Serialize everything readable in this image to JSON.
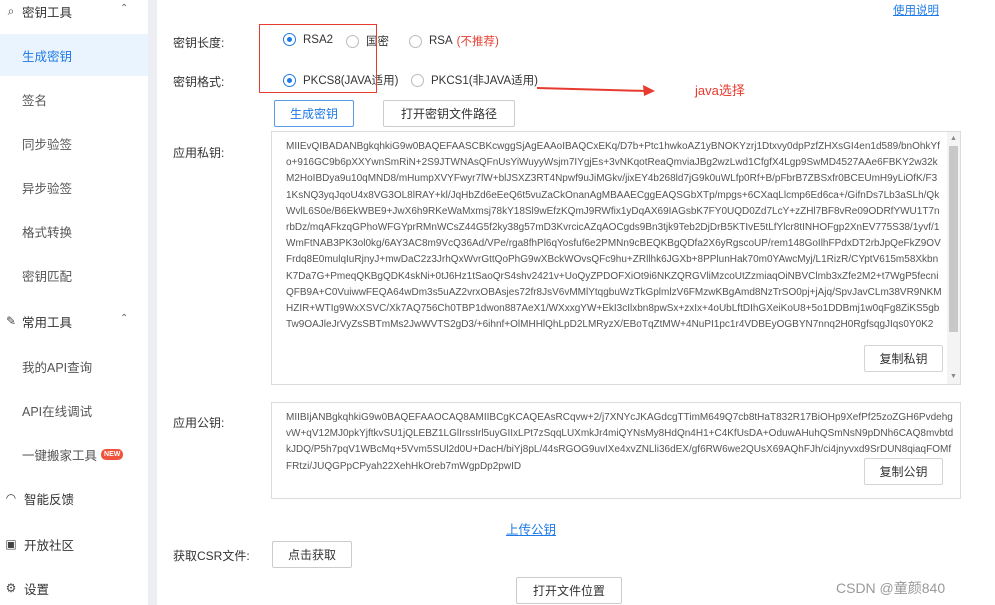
{
  "sidebar": {
    "group1": {
      "label": "密钥工具",
      "icon": "search-icon"
    },
    "items1": [
      {
        "label": "生成密钥",
        "active": true
      },
      {
        "label": "签名"
      },
      {
        "label": "同步验签"
      },
      {
        "label": "异步验签"
      },
      {
        "label": "格式转换"
      },
      {
        "label": "密钥匹配"
      }
    ],
    "group2": {
      "label": "常用工具",
      "icon": "wrench-icon"
    },
    "items2": [
      {
        "label": "我的API查询"
      },
      {
        "label": "API在线调试"
      },
      {
        "label": "一键搬家工具",
        "badge": "NEW"
      }
    ],
    "bottom": [
      {
        "label": "智能反馈",
        "icon": "headset-icon"
      },
      {
        "label": "开放社区",
        "icon": "community-icon"
      },
      {
        "label": "设置",
        "icon": "gear-icon"
      }
    ]
  },
  "main": {
    "help_link": "使用说明",
    "key_length": {
      "label": "密钥长度:",
      "options": [
        "RSA2",
        "国密",
        "RSA"
      ],
      "selected": "RSA2",
      "rsa_warning": "(不推荐)"
    },
    "key_format": {
      "label": "密钥格式:",
      "options": [
        "PKCS8(JAVA适用)",
        "PKCS1(非JAVA适用)"
      ],
      "selected": "PKCS8(JAVA适用)"
    },
    "annotation": "java选择",
    "buttons": {
      "generate": "生成密钥",
      "open_path": "打开密钥文件路径"
    },
    "private_key": {
      "label": "应用私钥:",
      "value": "MIIEvQIBADANBgkqhkiG9w0BAQEFAASCBKcwggSjAgEAAoIBAQCxEKq/D7b+Ptc1hwkoAZ1yBNOKYzrj1Dtxvy0dpPzfZHXsGI4en1d589/bnOhkYfo+916GC9b6pXXYwnSmRiN+2S9JTWNAsQFnUsYiWuyyWsjm7IYgjEs+3vNKqotReaQmviaJBg2wzLwd1CfgfX4Lgp9SwMD4527AAe6FBKY2w32kM2HoIBDya9u10qMND8/mHumpXVYFwyr7lW+blJSXZ3RT4Npwf9uJiMGkv/jixEY4b268ld7jG9k0uWLfp0Rf+B/pFbrB7ZBSxfr0BCEUmH9yLiOfK/F31KsNQ3yqJqoU4x8VG3OL8lRAY+kl/JqHbZd6eEeQ6t5vuZaCkOnanAgMBAAECggEAQSGbXTp/mpgs+6CXaqLlcmp6Ed6ca+/GifnDs7Lb3aSLh/QkWvlL6S0e/B6EkWBE9+JwX6h9RKeWaMxmsj78kY18Sl9wEfzKQmJ9RWfix1yDqAX69IAGsbK7FY0UQD0Zd7LcY+zZHl7BF8vRe09ODRfYWU1T7nrbDz/mqAFkzqGPhoWFGYprRMnWCsZ44G5f2ky38g57mD3KvrcicAZqAOCgds9Bn3tjk9Teb2DjDrB5KTIvE5tLfYlcr8tINHOFgp2XnEV775S38/1yvf/1WmFtNAB3PK3ol0kg/6AY3AC8m9VcQ36Ad/VPe/rga8fhPl6qYosfuf6e2PMNn9cBEQKBgQDfa2X6yRgscoUP/rem148GoIlhFPdxDT2rbJpQeFkZ9OVFrdq8E0mulqIuRjnyJ+mwDaC2z3JrhQxWvrGttQoPhG9wXBckWOvsQFc9hu+ZRllhk6JGXb+8PPlunHak70m0YAwcMyj/L1RizR/CYptV615m58XkbnK7Da7G+PmeqQKBgQDK4skNi+0tJ6Hz1tSaoQrS4shv2421v+UoQyZPDOFXiOt9i6NKZQRGVliMzcoUtZzmiaqOiNBVClmb3xZfe2M2+t7WgP5fecniQFB9A+C0VuiwwFEQA64wDm3s5uAZ2vrxOBAsjes72fr8JsV6vMMlYtqgbuWzTkGplmlzV6FMzwKBgAmd8NzTrSO0pj+jAjq/SpvJavCLm38VR9NKMHZIR+WTIg9WxXSVC/Xk7AQ756Ch0TBP1dwon887AeX1/WXxxgYW+EkI3cIlxbn8pwSx+zxIx+4oUbLftDIhGXeiKoU8+5o1DDBmj1w0qFg8ZiKS5gbTw9OAJleJrVyZsSBTmMs2JwWVTS2gD3/+6ihnf+OlMHHlQhLpD2LMRyzX/EBoTqZtMW+4NuPI1pc1r4VDBEyOGBYN7nnq2H0RgfsqgJIqs0Y0K2",
      "copy": "复制私钥"
    },
    "public_key": {
      "label": "应用公钥:",
      "value": "MIIBIjANBgkqhkiG9w0BAQEFAAOCAQ8AMIIBCgKCAQEAsRCqvw+2/j7XNYcJKAGdcgTTimM649Q7cb8tHaT832R17BiOHp9XefPf25zoZGH6PvdehgvW+qV12MJ0pkYjftkvSU1jQLEBZ1LGlIrssIrl5uyGIIxLPt7zSqqLUXmkJr4miQYNsMy8HdQn4H1+C4KfUsDA+OduwAHuhQSmNsN9pDNh6CAQ8mvbtdkJDQ/P5h7pqV1WBcMq+5Vvm5SUl2d0U+DacH/biYj8pL/44sRGOG9uvIXe4xvZNLli36dEX/gf6RW6we2QUsX69AQhFJh/ci4jnyvxd9SrDUN8qiaqFOMfFRtzi/JUQGPpCPyah22XehHkOreb7mWgpDp2pwID",
      "copy": "复制公钥"
    },
    "upload_link": "上传公钥",
    "csr": {
      "label": "获取CSR文件:",
      "button": "点击获取"
    },
    "open_location": "打开文件位置"
  },
  "watermark": "CSDN @童颜840"
}
